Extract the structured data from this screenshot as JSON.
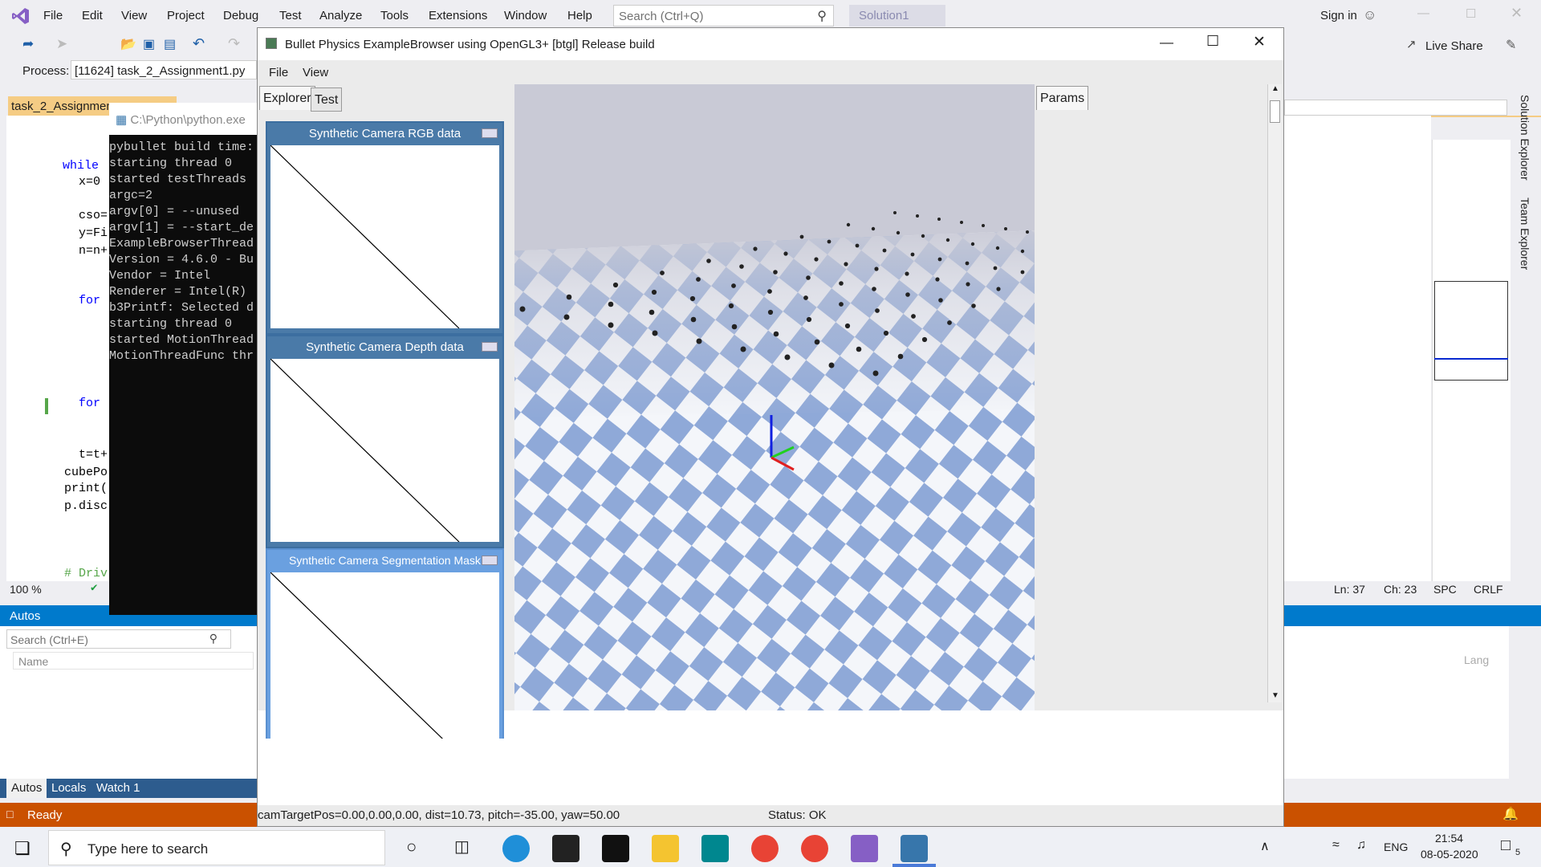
{
  "vs": {
    "menu": [
      "File",
      "Edit",
      "View",
      "Project",
      "Debug",
      "Test",
      "Analyze",
      "Tools",
      "Extensions",
      "Window",
      "Help"
    ],
    "search_placeholder": "Search (Ctrl+Q)",
    "solution": "Solution1",
    "signin": "Sign in",
    "liveshare": "Live Share",
    "process_label": "Process:",
    "process_value": "[11624] task_2_Assignment1.py",
    "doc_tab": "task_2_Assignmen",
    "zoom": "100 %",
    "code": [
      "while",
      "x=0",
      "cso=",
      "y=Fi",
      "n=n+",
      "for",
      "for",
      "t=t+",
      "cubePo",
      "print(",
      "p.disc",
      "# Driv"
    ],
    "status": {
      "ready": "Ready",
      "ln": "Ln: 37",
      "ch": "Ch: 23",
      "spc": "SPC",
      "crlf": "CRLF"
    },
    "autos": {
      "title": "Autos",
      "search": "Search (Ctrl+E)",
      "col_name": "Name",
      "col_lang": "Lang",
      "tabs": [
        "Autos",
        "Locals",
        "Watch 1"
      ]
    },
    "side_tabs": [
      "Solution Explorer",
      "Team Explorer"
    ]
  },
  "console": {
    "title": "C:\\Python\\python.exe",
    "lines": [
      "pybullet build time:",
      "starting thread 0",
      "started testThreads",
      "argc=2",
      "argv[0] = --unused",
      "argv[1] = --start_de",
      "ExampleBrowserThread",
      "Version = 4.6.0 - Bu",
      "Vendor = Intel",
      "Renderer = Intel(R)",
      "b3Printf: Selected d",
      "starting thread 0",
      "started MotionThread",
      "MotionThreadFunc thr"
    ]
  },
  "bullet": {
    "title": "Bullet Physics ExampleBrowser using OpenGL3+ [btgl] Release build",
    "menu": [
      "File",
      "View"
    ],
    "tabs": [
      "Explorer",
      "Test"
    ],
    "params": "Params",
    "cams": [
      "Synthetic Camera RGB data",
      "Synthetic Camera Depth data",
      "Synthetic Camera Segmentation Mask"
    ],
    "status_left": "camTargetPos=0.00,0.00,0.00, dist=10.73, pitch=-35.00, yaw=50.00",
    "status_right": "Status: OK"
  },
  "taskbar": {
    "search": "Type here to search",
    "lang": "ENG",
    "time": "21:54",
    "date": "08-05-2020",
    "notif": "5"
  },
  "colors": {
    "vs_status": "#ca5100",
    "accent": "#007acc",
    "taskbar": "#eef0f5"
  }
}
